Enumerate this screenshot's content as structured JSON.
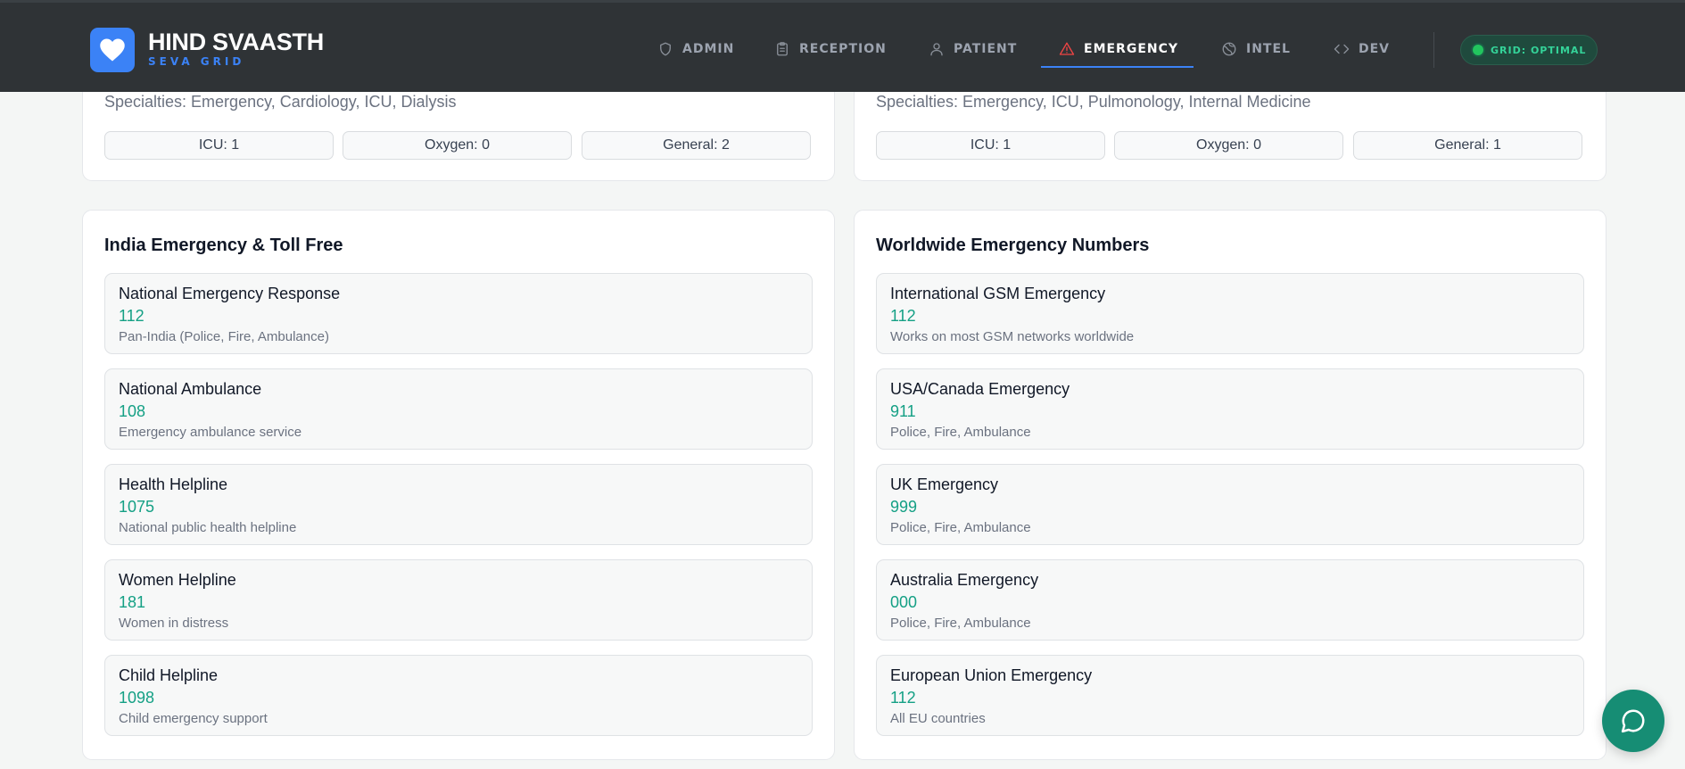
{
  "brand": {
    "title": "HIND SVAASTH",
    "subtitle": "SEVA GRID",
    "logo_icon": "heart-icon"
  },
  "nav": {
    "items": [
      {
        "label": "ADMIN",
        "icon": "shield-icon"
      },
      {
        "label": "RECEPTION",
        "icon": "clipboard-icon"
      },
      {
        "label": "PATIENT",
        "icon": "user-icon"
      },
      {
        "label": "EMERGENCY",
        "icon": "alert-triangle-icon",
        "active": true
      },
      {
        "label": "INTEL",
        "icon": "brain-icon"
      },
      {
        "label": "DEV",
        "icon": "code-icon"
      }
    ],
    "status": "GRID: OPTIMAL"
  },
  "hospitals": [
    {
      "specialties": "Specialties: Emergency, Cardiology, ICU, Dialysis",
      "beds": [
        "ICU: 1",
        "Oxygen: 0",
        "General: 2"
      ]
    },
    {
      "specialties": "Specialties: Emergency, ICU, Pulmonology, Internal Medicine",
      "beds": [
        "ICU: 1",
        "Oxygen: 0",
        "General: 1"
      ]
    }
  ],
  "india": {
    "title": "India Emergency & Toll Free",
    "entries": [
      {
        "name": "National Emergency Response",
        "number": "112",
        "desc": "Pan-India (Police, Fire, Ambulance)"
      },
      {
        "name": "National Ambulance",
        "number": "108",
        "desc": "Emergency ambulance service"
      },
      {
        "name": "Health Helpline",
        "number": "1075",
        "desc": "National public health helpline"
      },
      {
        "name": "Women Helpline",
        "number": "181",
        "desc": "Women in distress"
      },
      {
        "name": "Child Helpline",
        "number": "1098",
        "desc": "Child emergency support"
      }
    ]
  },
  "world": {
    "title": "Worldwide Emergency Numbers",
    "entries": [
      {
        "name": "International GSM Emergency",
        "number": "112",
        "desc": "Works on most GSM networks worldwide"
      },
      {
        "name": "USA/Canada Emergency",
        "number": "911",
        "desc": "Police, Fire, Ambulance"
      },
      {
        "name": "UK Emergency",
        "number": "999",
        "desc": "Police, Fire, Ambulance"
      },
      {
        "name": "Australia Emergency",
        "number": "000",
        "desc": "Police, Fire, Ambulance"
      },
      {
        "name": "European Union Emergency",
        "number": "112",
        "desc": "All EU countries"
      }
    ]
  },
  "colors": {
    "header_bg": "#2f3336",
    "accent_blue": "#3b82f6",
    "accent_green": "#15a085",
    "alert_red": "#ef4444"
  },
  "chat": {
    "icon": "chat-bubble-icon"
  }
}
